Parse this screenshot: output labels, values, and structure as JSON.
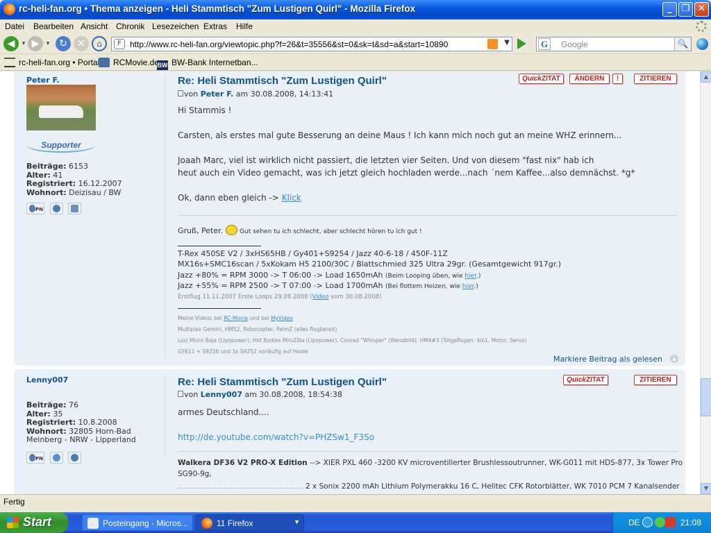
{
  "window": {
    "title": "rc-heli-fan.org • Thema anzeigen - Heli Stammtisch \"Zum Lustigen Quirl\" - Mozilla Firefox"
  },
  "menu": [
    "Datei",
    "Bearbeiten",
    "Ansicht",
    "Chronik",
    "Lesezeichen",
    "Extras",
    "Hilfe"
  ],
  "address": {
    "url": "http://www.rc-heli-fan.org/viewtopic.php?f=26&t=35556&st=0&sk=t&sd=a&start=10890",
    "site_icon": "F"
  },
  "search": {
    "engine_icon": "G",
    "placeholder": "Google"
  },
  "bookmarks": [
    {
      "label": "rc-heli-fan.org • Portal",
      "icon": "heli-icon"
    },
    {
      "label": "RCMovie.de",
      "icon": "clapper-icon"
    },
    {
      "label": "BW-Bank Internetban...",
      "icon": "bw-icon",
      "icon_text": "BW"
    }
  ],
  "posts": [
    {
      "author": "Peter F.",
      "supporter_badge": "Supporter",
      "stats": [
        {
          "label": "Beiträge:",
          "value": "6153"
        },
        {
          "label": "Alter:",
          "value": "41"
        },
        {
          "label": "Registriert:",
          "value": "16.12.2007"
        },
        {
          "label": "Wohnort:",
          "value": "Deizisau / BW"
        }
      ],
      "title": "Re: Heli Stammtisch \"Zum Lustigen Quirl\"",
      "by_prefix": "von",
      "by_author": "Peter F.",
      "by_date": "am 30.08.2008, 14:13:41",
      "buttons": {
        "quick": "Quick",
        "zitat": "ZITAT",
        "aendern": "ÄNDERN",
        "warn": "!",
        "zitieren": "ZITIEREN"
      },
      "text": [
        "Hi Stammis !",
        "Carsten, als erstes mal gute Besserung an deine Maus ! Ich kann mich noch gut an meine WHZ erinnern...",
        "Joaah Marc, viel ist wirklich nicht passiert, die letzten vier Seiten. Und von diesem \"fast nix\" hab ich",
        "heut auch ein Video gemacht, was ich jetzt gleich hochladen werde...nach ´nem Kaffee...also demnächst. *g*",
        "Ok, dann eben gleich -> "
      ],
      "link_text": "Klick",
      "sig_greeting": "Gruß, Peter.",
      "sig_motto": "Gut sehen tu ich schlecht, aber schlecht hören tu ich gut !",
      "sig_lines": [
        "T-Rex 450SE V2 / 3xHS65HB / Gy401+S9254 / Jazz 40-6-18 / 450F-11Z",
        "MX16s+SMC16scan / 5xKokam H5 2100/30C / Blattschmied 325 Ultra 29gr. (Gesamtgewicht 917gr.)"
      ],
      "jazz_lines": [
        {
          "main": "Jazz +80% = RPM 3000 -> T 06:00 -> Load 1650mAh",
          "note": "(Beim Looping üben, wie ",
          "link": "hier",
          "end": ".)"
        },
        {
          "main": "Jazz +55% = RPM 2500 -> T 07:00 -> Load 1700mAh",
          "note": "(Bei flottem Heizen, wie ",
          "link": "hier",
          "end": ".)"
        }
      ],
      "first_flight": {
        "pre": "Erstflug 11.11.2007 Erste Loops 29.08.2008 (",
        "link": "Video",
        "post": " vom 30.08.2008)"
      },
      "small_lines": [
        {
          "pre": "Meine Videos bei ",
          "link1": "RC-Movie",
          "mid": " und bei ",
          "link2": "MyVideo"
        },
        {
          "text": "Multiplex Gemini, HM52, Robocopter, PalmZ (alles flugbereit)"
        },
        {
          "text": "Losi Micro Baja (Lipopower), Hot Bodies MiniZilla (Lipopower), Conrad \"Whisper\" (Wandbild), HM4#3 (Totgeflogen: 4in1, Motor, Servo)"
        },
        {
          "text": "GY611 + S9256 und 3x S9252 vorläufig auf Halde"
        }
      ],
      "mark_read": "Markiere Beitrag als gelesen"
    },
    {
      "author": "Lenny007",
      "stats": [
        {
          "label": "Beiträge:",
          "value": "76"
        },
        {
          "label": "Alter:",
          "value": "35"
        },
        {
          "label": "Registriert:",
          "value": "10.8.2008"
        },
        {
          "label": "Wohnort:",
          "value": "32805 Horn-Bad"
        }
      ],
      "location2": "Meinberg - NRW - Lipperland",
      "title": "Re: Heli Stammtisch \"Zum Lustigen Quirl\"",
      "by_prefix": "von",
      "by_author": "Lenny007",
      "by_date": "am 30.08.2008, 18:54:38",
      "buttons": {
        "quick": "Quick",
        "zitat": "ZITAT",
        "zitieren": "ZITIEREN"
      },
      "text": [
        "armes Deutschland...."
      ],
      "url_text": "http://de.youtube.com/watch?v=PHZSw1_F3So",
      "sig_bold": "Walkera DF36 V2 PRO-X Edition",
      "sig_rest": " --> XIER PXL 460 -3200 KV microventilierter Brushlessoutrunner, WK-G011 mit HDS-877, 3x Tower Pro",
      "sig_line2": "SG90-9g,",
      "sig_line3": "2 x Sonix 2200 mAh Lithium Polymerakku 16 C, Helitec CFK Rotorblätter, WK 7010 PCM 7 Kanalsender"
    }
  ],
  "status": "Fertig",
  "taskbar": {
    "start": "Start",
    "tasks": [
      {
        "label": "Posteingang - Micros..."
      },
      {
        "label": "11 Firefox"
      }
    ],
    "lang": "DE",
    "clock": "21:08"
  },
  "colors": {
    "post_bg": "#E9F1F6",
    "link": "#368AD2",
    "title": "#105289",
    "button_red": "#B8231B"
  }
}
